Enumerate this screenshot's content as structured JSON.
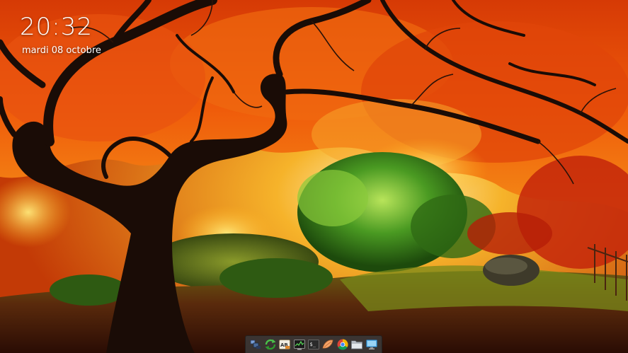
{
  "desktop": {
    "clock": {
      "time": "20:32",
      "date": "mardi 08 octobre"
    }
  },
  "dock": {
    "items": [
      {
        "id": "show-desktop",
        "icon": "show-desktop-icon"
      },
      {
        "id": "update-manager",
        "icon": "refresh-icon"
      },
      {
        "id": "font-viewer",
        "icon": "font-viewer-icon"
      },
      {
        "id": "system-monitor",
        "icon": "system-monitor-icon"
      },
      {
        "id": "terminal",
        "icon": "terminal-icon"
      },
      {
        "id": "text-editor",
        "icon": "text-editor-icon"
      },
      {
        "id": "chrome",
        "icon": "chrome-icon"
      },
      {
        "id": "file-manager",
        "icon": "folder-icon"
      },
      {
        "id": "display-settings",
        "icon": "monitor-icon"
      }
    ]
  },
  "colors": {
    "dock_background": "#3c3c3c",
    "clock_text": "#ffffff"
  }
}
